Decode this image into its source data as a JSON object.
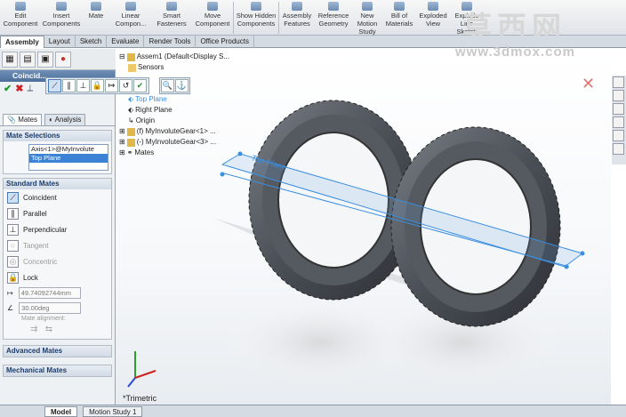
{
  "ribbon": [
    {
      "label": "Edit Component"
    },
    {
      "label": "Insert Components"
    },
    {
      "label": "Mate"
    },
    {
      "label": "Linear Compon..."
    },
    {
      "label": "Smart Fasteners"
    },
    {
      "label": "Move Component"
    },
    {
      "label": "Show Hidden Components"
    },
    {
      "label": "Assembly Features"
    },
    {
      "label": "Reference Geometry"
    },
    {
      "label": "New Motion Study"
    },
    {
      "label": "Bill of Materials"
    },
    {
      "label": "Exploded View"
    },
    {
      "label": "Explode Line Sketch"
    }
  ],
  "tabs": [
    "Assembly",
    "Layout",
    "Sketch",
    "Evaluate",
    "Render Tools",
    "Office Products"
  ],
  "pm": {
    "title": "Coincid...",
    "tab_mates": "Mates",
    "tab_analysis": "Analysis",
    "mate_selections": "Mate Selections",
    "selections": [
      "Axis<1>@MyInvolute",
      "Top Plane"
    ],
    "standard_mates": "Standard Mates",
    "mates": [
      "Coincident",
      "Parallel",
      "Perpendicular",
      "Tangent",
      "Concentric",
      "Lock"
    ],
    "distance_value": "49.74092744mm",
    "angle_value": "30.00deg",
    "mate_alignment": "Mate alignment:",
    "advanced_mates": "Advanced Mates",
    "mechanical_mates": "Mechanical Mates"
  },
  "tree": {
    "root": "Assem1 (Default<Display S...",
    "items": [
      "Sensors",
      "Top Plane",
      "Right Plane",
      "Origin",
      "(f) MyInvoluteGear<1> ...",
      "(-) MyInvoluteGear<3> ...",
      "Mates"
    ]
  },
  "viewport": {
    "plane_label": "Top Plane",
    "view_label": "*Trimetric"
  },
  "status": {
    "tab_model": "Model",
    "tab_motion": "Motion Study 1"
  },
  "watermark": {
    "cn": "莫西网",
    "url": "www.3dmox.com"
  },
  "colors": {
    "accent": "#4c6e98",
    "ok": "#1b9a2a",
    "cancel": "#d0202a",
    "selection": "#3c83d6",
    "plane": "#3a8fe0"
  }
}
